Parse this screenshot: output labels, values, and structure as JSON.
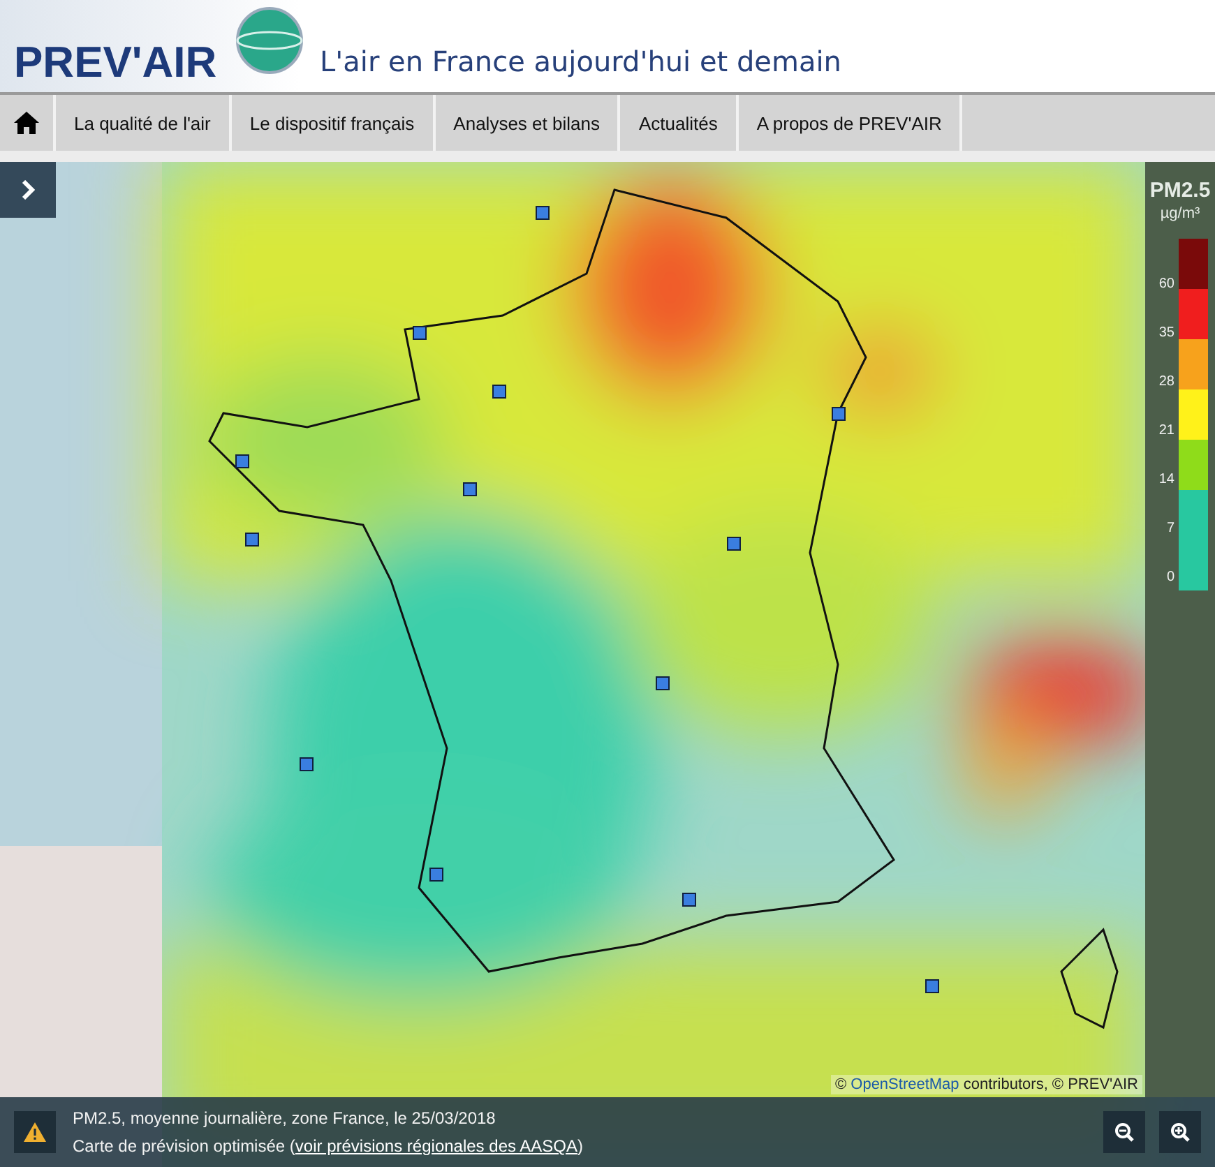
{
  "header": {
    "logo": "PREV'AIR",
    "title": "L'air en France aujourd'hui et demain"
  },
  "nav": {
    "items": [
      {
        "label": "La qualité de l'air"
      },
      {
        "label": "Le dispositif français"
      },
      {
        "label": "Analyses et bilans"
      },
      {
        "label": "Actualités"
      },
      {
        "label": "A propos de PREV'AIR"
      }
    ]
  },
  "legend": {
    "title": "PM2.5",
    "unit": "µg/m³",
    "bands": [
      {
        "color": "#7a0a0a"
      },
      {
        "color": "#f01e1e"
      },
      {
        "color": "#f7a21c"
      },
      {
        "color": "#fff21a"
      },
      {
        "color": "#8fdc1a"
      },
      {
        "color": "#28c8a0"
      },
      {
        "color": "#28c8a0"
      }
    ],
    "ticks": [
      "60",
      "35",
      "28",
      "21",
      "14",
      "7",
      "0"
    ]
  },
  "attribution": {
    "prefix": "© ",
    "link": "OpenStreetMap",
    "suffix": " contributors, © PREV'AIR"
  },
  "info": {
    "caption": "PM2.5, moyenne journalière, zone France, le 25/03/2018",
    "note_prefix": "Carte de prévision optimisée (",
    "note_link": "voir prévisions régionales des AASQA",
    "note_suffix": ")"
  }
}
